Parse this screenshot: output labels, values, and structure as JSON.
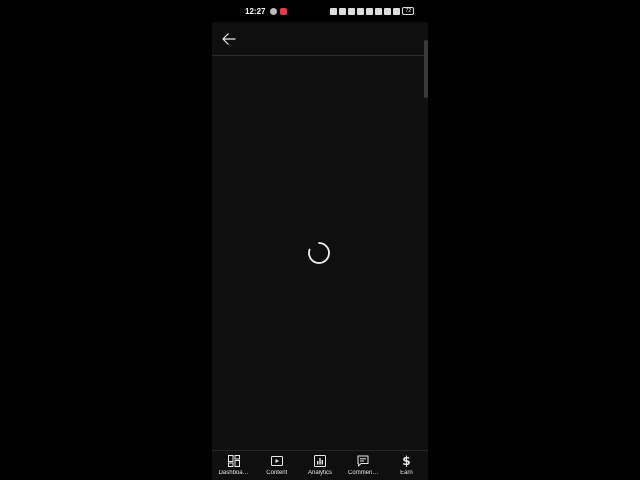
{
  "status_bar": {
    "time": "12:27",
    "battery": "72"
  },
  "bottom_nav": {
    "items": [
      {
        "label": "Dashboa…",
        "icon": "dashboard-icon"
      },
      {
        "label": "Content",
        "icon": "content-play-icon"
      },
      {
        "label": "Analytics",
        "icon": "analytics-bar-chart-icon"
      },
      {
        "label": "Commen…",
        "icon": "comment-icon"
      },
      {
        "label": "Earn",
        "icon": "dollar-icon",
        "glyph": "$"
      }
    ]
  },
  "colors": {
    "background": "#0f0f0f",
    "notification_accent": "#e53950",
    "text": "#e8e8e8"
  }
}
